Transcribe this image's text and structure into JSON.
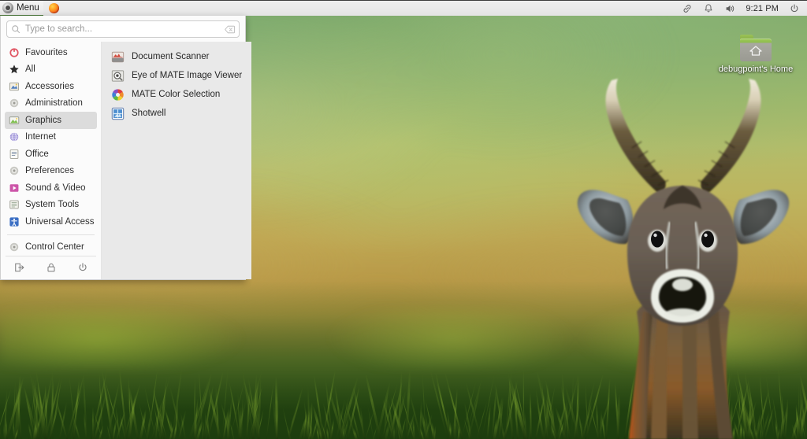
{
  "panel": {
    "menu_button_label": "Menu",
    "menu_icon_name": "mate-logo-icon",
    "firefox_icon_name": "firefox-icon",
    "clock": "9:21 PM",
    "tray": [
      {
        "name": "link-icon",
        "label": "Link"
      },
      {
        "name": "bell-icon",
        "label": "Notifications"
      },
      {
        "name": "volume-icon",
        "label": "Volume"
      }
    ],
    "power_icon_name": "power-icon",
    "background_color": "#e9e9e9",
    "accent_color": "#4c7a3a"
  },
  "menu": {
    "search": {
      "placeholder": "Type to search...",
      "value": "",
      "search_icon_name": "search-icon",
      "clear_icon_name": "clear-icon"
    },
    "categories": [
      {
        "label": "Favourites",
        "icon": "favourites-icon",
        "selected": false
      },
      {
        "label": "All",
        "icon": "star-icon",
        "selected": false
      },
      {
        "label": "Accessories",
        "icon": "accessories-icon",
        "selected": false
      },
      {
        "label": "Administration",
        "icon": "administration-icon",
        "selected": false
      },
      {
        "label": "Graphics",
        "icon": "graphics-icon",
        "selected": true
      },
      {
        "label": "Internet",
        "icon": "internet-icon",
        "selected": false
      },
      {
        "label": "Office",
        "icon": "office-icon",
        "selected": false
      },
      {
        "label": "Preferences",
        "icon": "preferences-icon",
        "selected": false
      },
      {
        "label": "Sound & Video",
        "icon": "sound-video-icon",
        "selected": false
      },
      {
        "label": "System Tools",
        "icon": "system-tools-icon",
        "selected": false
      },
      {
        "label": "Universal Access",
        "icon": "universal-access-icon",
        "selected": false
      }
    ],
    "control_center": {
      "label": "Control Center",
      "icon": "control-center-icon"
    },
    "session_buttons": [
      {
        "name": "logout-button",
        "icon": "logout-icon",
        "label": "Log Out"
      },
      {
        "name": "lock-button",
        "icon": "lock-icon",
        "label": "Lock Screen"
      },
      {
        "name": "shutdown-button",
        "icon": "power-icon",
        "label": "Shut Down"
      }
    ],
    "applications": [
      {
        "label": "Document Scanner",
        "icon": "scanner-icon"
      },
      {
        "label": "Eye of MATE Image Viewer",
        "icon": "eom-icon"
      },
      {
        "label": "MATE Color Selection",
        "icon": "color-wheel-icon"
      },
      {
        "label": "Shotwell",
        "icon": "shotwell-icon"
      }
    ],
    "selected_color": "#dcdcdc",
    "sidebar_bg": "#fbfbfb",
    "applist_bg": "#e9e9e9"
  },
  "desktop": {
    "icons": [
      {
        "label": "debugpoint's Home",
        "icon": "home-folder-icon"
      }
    ],
    "wallpaper_name": "antelope-grassland-wallpaper"
  }
}
